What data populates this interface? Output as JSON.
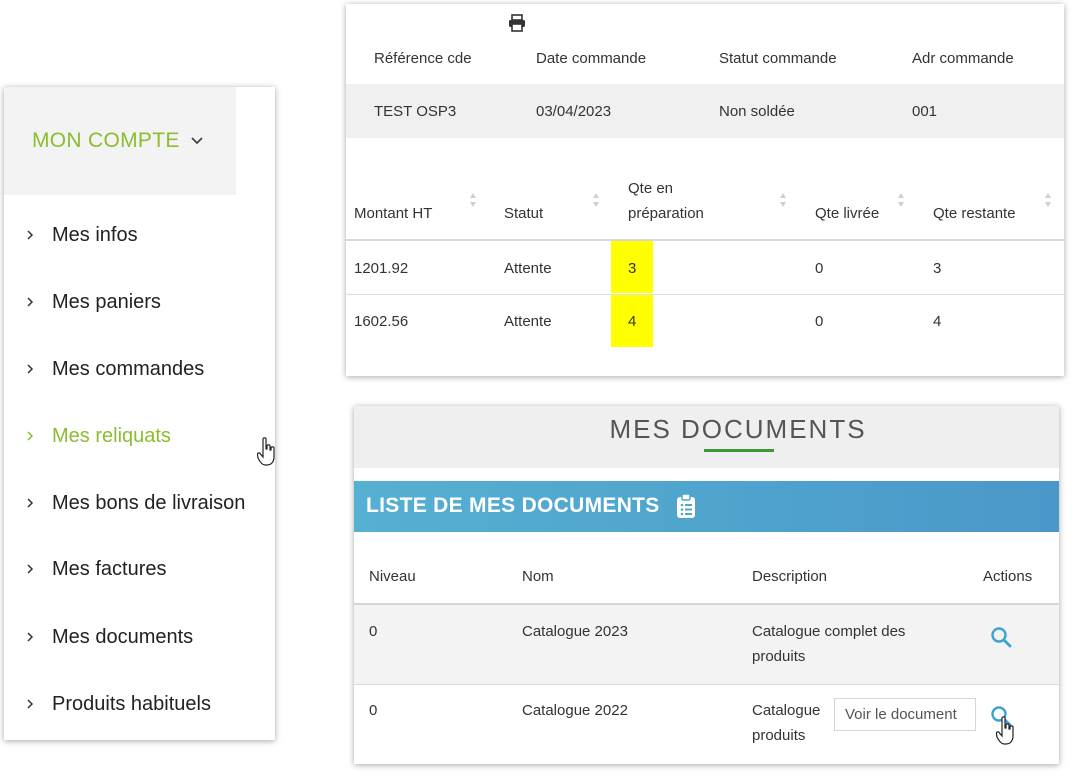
{
  "menu": {
    "header": "MON COMPTE",
    "items": [
      {
        "label": "Mes infos",
        "active": false
      },
      {
        "label": "Mes paniers",
        "active": false
      },
      {
        "label": "Mes commandes",
        "active": false
      },
      {
        "label": "Mes reliquats",
        "active": true
      },
      {
        "label": "Mes bons de livraison",
        "active": false
      },
      {
        "label": "Mes factures",
        "active": false
      },
      {
        "label": "Mes documents",
        "active": false
      },
      {
        "label": "Produits habituels",
        "active": false
      }
    ]
  },
  "order": {
    "headers": {
      "ref": "Référence cde",
      "date": "Date commande",
      "status": "Statut commande",
      "addr": "Adr commande"
    },
    "row": {
      "ref": "TEST OSP3",
      "date": "03/04/2023",
      "status": "Non soldée",
      "addr": "001"
    },
    "lines_headers": {
      "amount": "Montant HT",
      "status": "Statut",
      "qty_prep_1": "Qte en",
      "qty_prep_2": "préparation",
      "qty_delivered": "Qte livrée",
      "qty_remaining": "Qte restante"
    },
    "lines": [
      {
        "amount": "1201.92",
        "status": "Attente",
        "qty_prep": "3",
        "qty_delivered": "0",
        "qty_remaining": "3"
      },
      {
        "amount": "1602.56",
        "status": "Attente",
        "qty_prep": "4",
        "qty_delivered": "0",
        "qty_remaining": "4"
      }
    ]
  },
  "documents": {
    "title": "MES DOCUMENTS",
    "list_title": "LISTE DE MES DOCUMENTS",
    "headers": {
      "level": "Niveau",
      "name": "Nom",
      "description": "Description",
      "actions": "Actions"
    },
    "rows": [
      {
        "level": "0",
        "name": "Catalogue 2023",
        "desc_1": "Catalogue complet des",
        "desc_2": "produits"
      },
      {
        "level": "0",
        "name": "Catalogue 2022",
        "desc_1": "Catalogue",
        "desc_2": "produits"
      }
    ],
    "tooltip": "Voir le document"
  },
  "colors": {
    "accent_green": "#8cbd2f",
    "highlight_yellow": "#ffff00",
    "doc_bar_blue": "#4fa6cf",
    "icon_blue": "#3aa3d6"
  }
}
